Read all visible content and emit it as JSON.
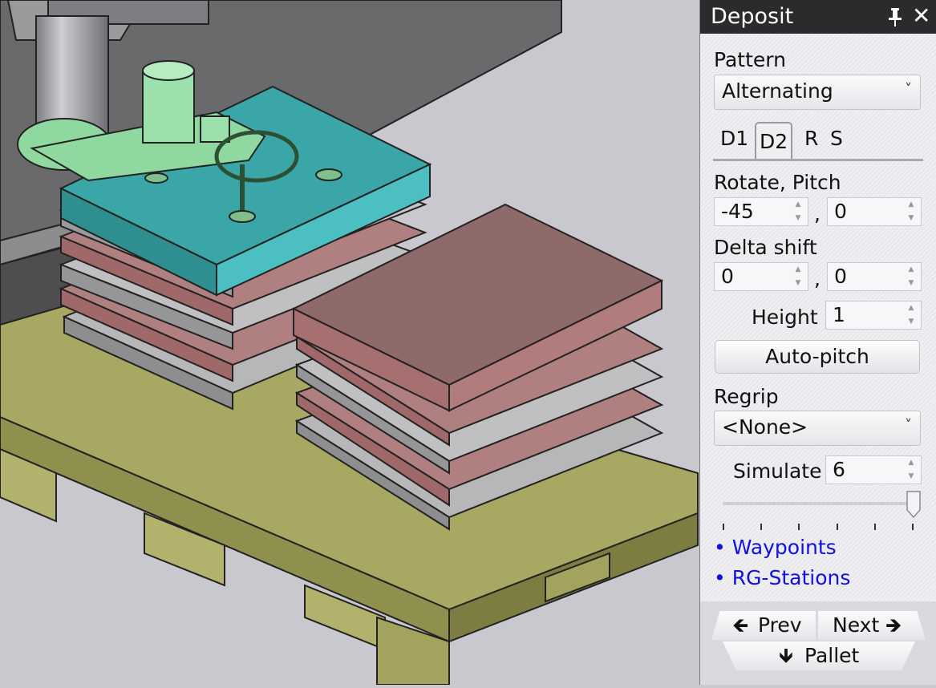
{
  "panel": {
    "title": "Deposit",
    "pin_icon": "pin-icon",
    "close_icon": "close-icon",
    "pattern": {
      "label": "Pattern",
      "value": "Alternating"
    },
    "tabs": [
      "D1",
      "D2",
      "R",
      "S"
    ],
    "active_tab": "D2",
    "rotate_pitch": {
      "label": "Rotate, Pitch",
      "rotate": "-45",
      "pitch": "0",
      "separator": ","
    },
    "delta_shift": {
      "label": "Delta shift",
      "x": "0",
      "y": "0",
      "separator": ","
    },
    "height": {
      "label": "Height",
      "value": "1"
    },
    "auto_pitch_label": "Auto-pitch",
    "regrip": {
      "label": "Regrip",
      "value": "<None>"
    },
    "simulate": {
      "label": "Simulate",
      "value": "6"
    },
    "slider_level": 1.0,
    "links": [
      "• Waypoints",
      "• RG-Stations"
    ],
    "nav": {
      "prev": "Prev",
      "next": "Next",
      "pallet": "Pallet"
    }
  },
  "colors": {
    "pallet": "#a8a862",
    "sheet_teal": "#3aa6a8",
    "sheet_rose": "#a57878",
    "sheet_gray": "#a7a7a9",
    "gripper": "#8fd8a0",
    "link_blue": "#1010e0",
    "titlebar": "#2b2b2e"
  }
}
